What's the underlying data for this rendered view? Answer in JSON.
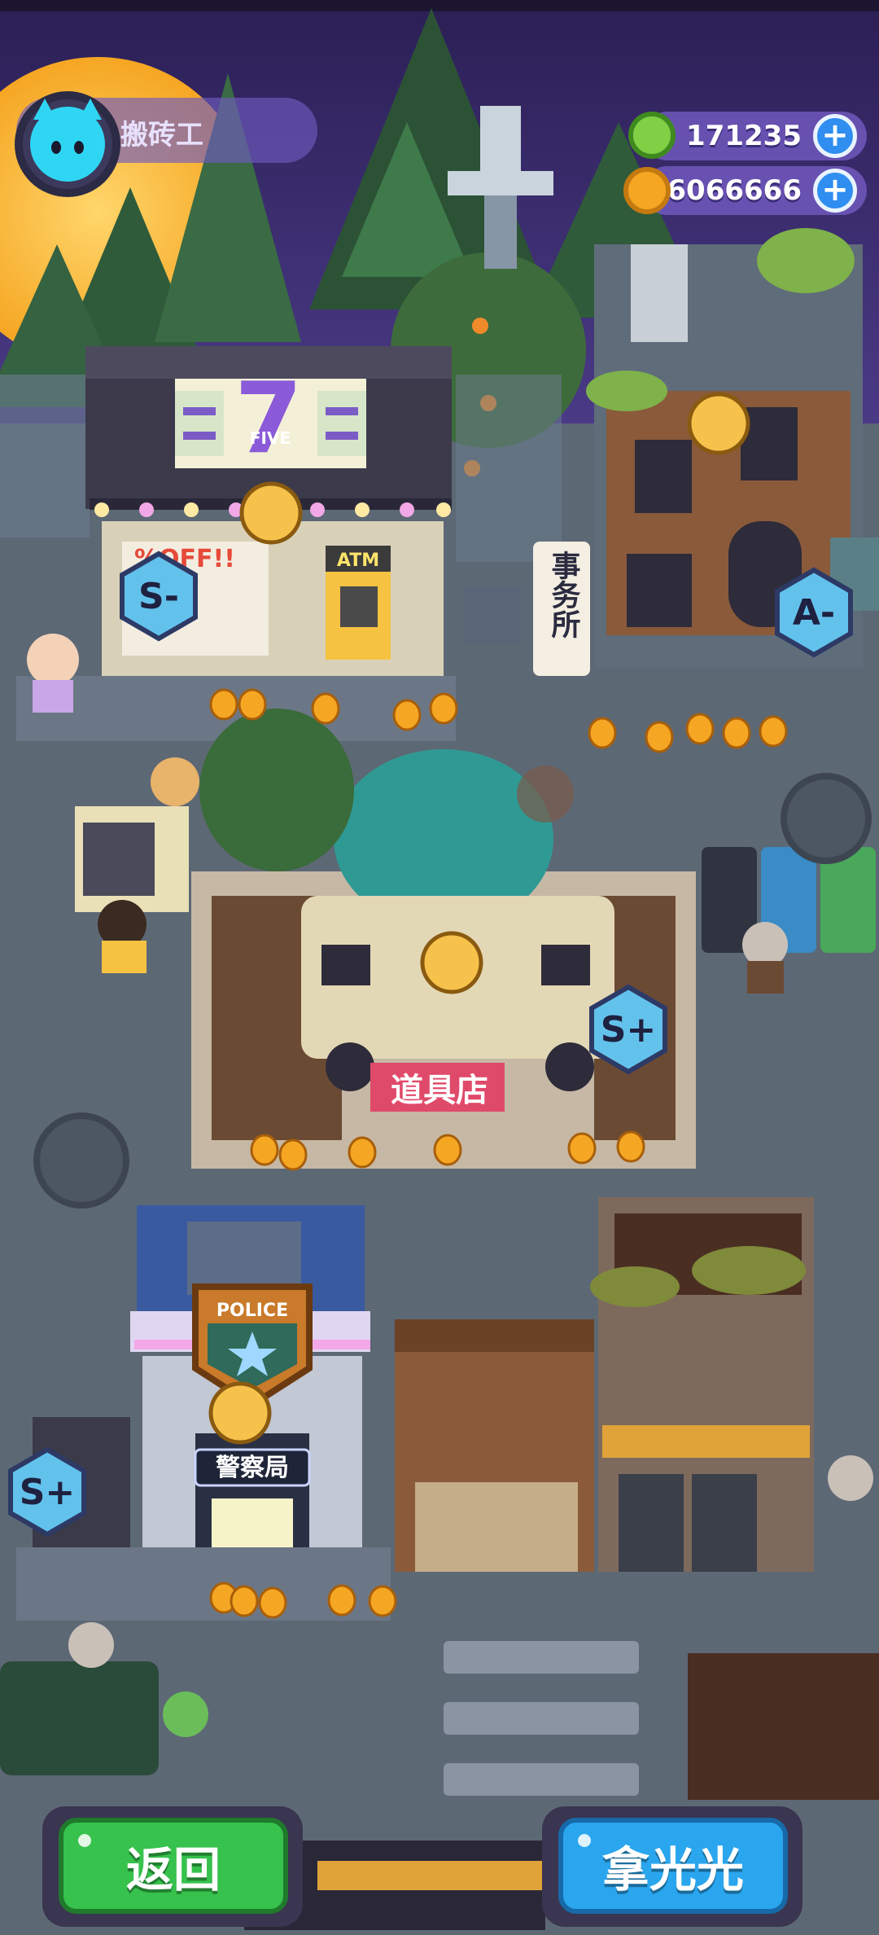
{
  "player": {
    "name": "搬砖工"
  },
  "resources": {
    "donut": "171235",
    "coin": "6066666"
  },
  "buildings": {
    "convenience_store": {
      "sign_number": "7",
      "sign_text": "FIVE",
      "promo": "%OFF!!",
      "atm": "ATM",
      "grade": "S-"
    },
    "office": {
      "sign": "事务所",
      "grade": "A-"
    },
    "item_shop": {
      "sign": "道具店",
      "grade": "S+"
    },
    "police": {
      "badge": "POLICE",
      "sign": "警察局",
      "grade": "S+"
    }
  },
  "buttons": {
    "back": "返回",
    "take_all": "拿光光"
  },
  "colors": {
    "sky": "#3a2b6b",
    "ground": "#5d6875",
    "coin": "#f5a623",
    "back_button": "#36c24c",
    "take_button": "#2aa6ee"
  }
}
